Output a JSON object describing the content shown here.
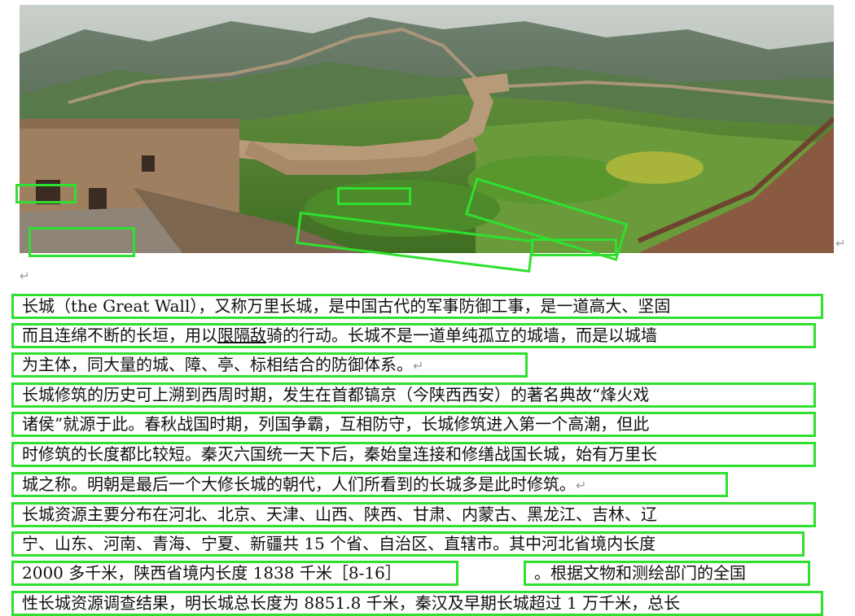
{
  "image": {
    "subject": "great-wall-photo"
  },
  "paragraph_mark": "↵",
  "lines": [
    {
      "pre": "长城（the Great Wall），又称万里长城，是中国古代的军事防御工事，是一道高大、坚固",
      "ul": "",
      "post": "",
      "ret": ""
    },
    {
      "pre": "而且连绵不断的长垣，用以",
      "ul": "限隔敌",
      "post": "骑的行动。长城不是一道单纯孤立的城墙，而是以城墙",
      "ret": ""
    },
    {
      "pre": "为主体，同大量的城、障、亭、标相结合的防御体系。",
      "ul": "",
      "post": "",
      "ret": "↵"
    },
    {
      "pre": "长城修筑的历史可上溯到西周时期，发生在首都镐京（今陕西西安）的著名典故“烽火戏",
      "ul": "",
      "post": "",
      "ret": ""
    },
    {
      "pre": "诸侯”就源于此。春秋战国时期，列国争霸，互相防守，长城修筑进入第一个高潮，但此",
      "ul": "",
      "post": "",
      "ret": ""
    },
    {
      "pre": "时修筑的长度都比较短。秦灭六国统一天下后，秦始皇连接和修缮战国长城，始有万里长",
      "ul": "",
      "post": "",
      "ret": ""
    },
    {
      "pre": "城之称。明朝是最后一个大修长城的朝代，人们所看到的长城多是此时修筑。",
      "ul": "",
      "post": "",
      "ret": "↵"
    },
    {
      "pre": "长城资源主要分布在河北、北京、天津、山西、陕西、甘肃、内蒙古、黑龙江、吉林、辽",
      "ul": "",
      "post": "",
      "ret": ""
    },
    {
      "pre": "宁、山东、河南、青海、宁夏、新疆共 15 个省、自治区、直辖市。其中河北省境内长度",
      "ul": "",
      "post": "",
      "ret": ""
    },
    {
      "pre": "2000 多千米，陕西省境内长度 1838 千米［8-16］",
      "ul": "",
      "post": "",
      "ret": ""
    },
    {
      "pre": "。根据文物和测绘部门的全国",
      "ul": "",
      "post": "",
      "ret": ""
    },
    {
      "pre": "性长城资源调查结果，明长城总长度为 8851.8 千米，秦汉及早期长城超过 1 万千米，总长",
      "ul": "",
      "post": "",
      "ret": ""
    }
  ],
  "colors": {
    "detection_box": "#2fe02f",
    "text": "#111111",
    "mark": "#9a9a9a"
  }
}
